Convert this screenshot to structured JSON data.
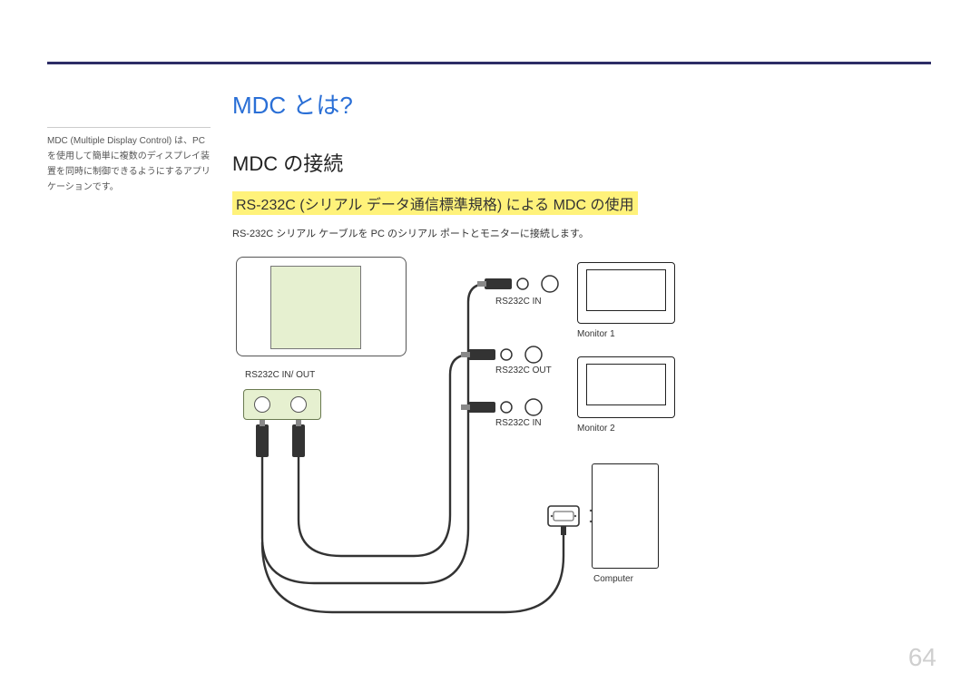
{
  "sidebar": {
    "note": "MDC (Multiple Display Control) は、PC を使用して簡単に複数のディスプレイ装置を同時に制御できるようにするアプリケーションです。"
  },
  "main": {
    "title": "MDC とは?",
    "section_title": "MDC の接続",
    "subsection_title": "RS-232C (シリアル データ通信標準規格) による MDC の使用",
    "body": "RS-232C シリアル ケーブルを PC のシリアル ポートとモニターに接続します。"
  },
  "labels": {
    "inout": "RS232C IN/ OUT",
    "in_top": "RS232C IN",
    "out": "RS232C OUT",
    "in_bottom": "RS232C IN",
    "mon1": "Monitor 1",
    "mon2": "Monitor 2",
    "computer": "Computer"
  },
  "page": "64"
}
